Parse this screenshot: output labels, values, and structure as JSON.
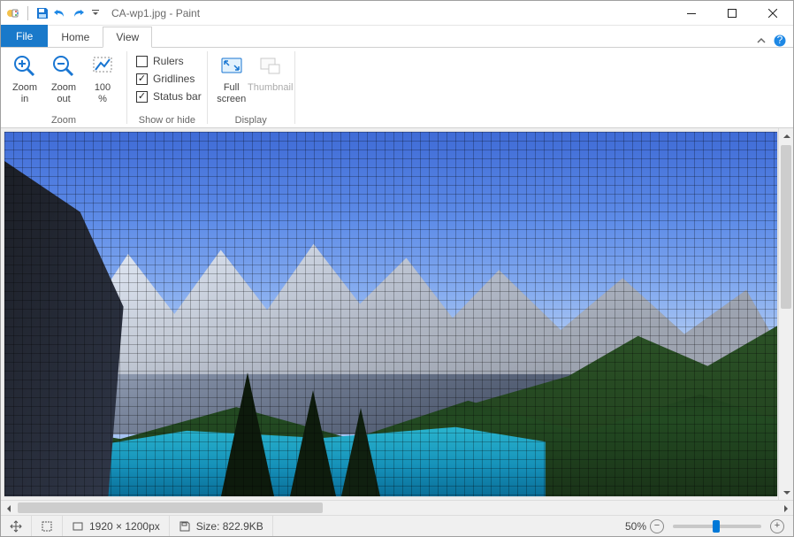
{
  "title": "CA-wp1.jpg - Paint",
  "tabs": {
    "file": "File",
    "home": "Home",
    "view": "View"
  },
  "ribbon": {
    "zoom": {
      "zoom_in": "Zoom\nin",
      "zoom_out": "Zoom\nout",
      "zoom_100": "100\n%",
      "group_label": "Zoom"
    },
    "show": {
      "rulers": "Rulers",
      "gridlines": "Gridlines",
      "statusbar": "Status bar",
      "group_label": "Show or hide"
    },
    "display": {
      "full_screen": "Full\nscreen",
      "thumbnail": "Thumbnail",
      "group_label": "Display"
    }
  },
  "status": {
    "dimensions": "1920 × 1200px",
    "size": "Size: 822.9KB",
    "zoom_percent": "50%"
  },
  "zoom_thumb_left_pct": 45
}
